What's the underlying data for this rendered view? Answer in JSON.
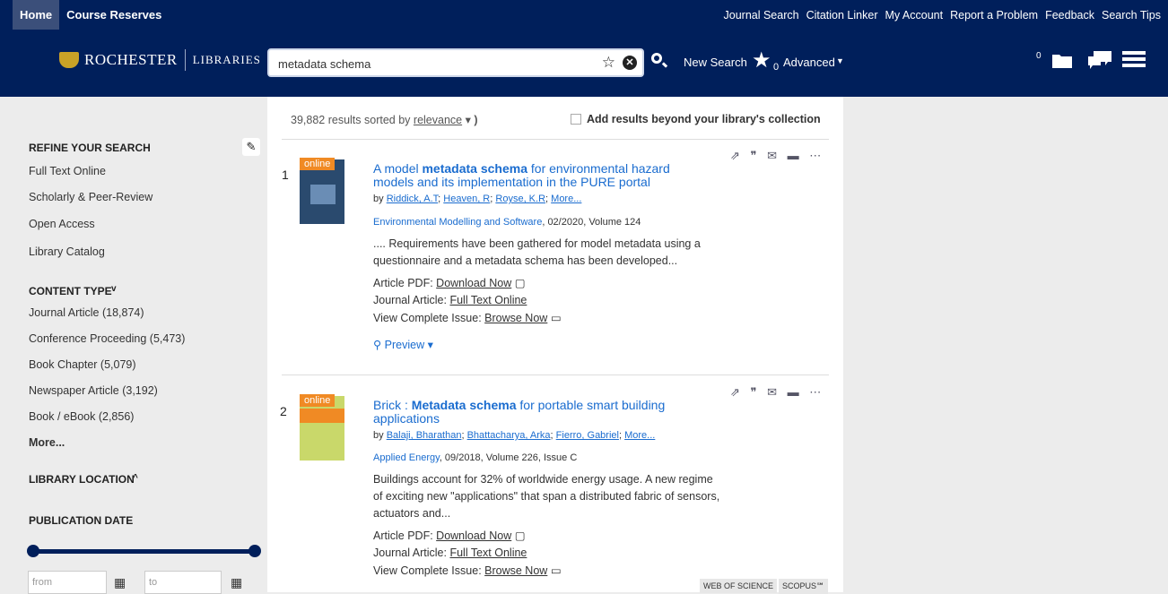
{
  "topnav": {
    "left": [
      "Home",
      "Course Reserves"
    ],
    "right": [
      "Journal Search",
      "Citation Linker",
      "My Account",
      "Report a Problem",
      "Feedback",
      "Search Tips"
    ]
  },
  "header": {
    "logo_uni": "ROCHESTER",
    "logo_lib": "LIBRARIES",
    "search_value": "metadata schema",
    "new_search": "New Search",
    "saved_count": "0",
    "advanced": "Advanced",
    "folder_count": "0"
  },
  "sidebar": {
    "refine": "REFINE YOUR SEARCH",
    "refine_items": [
      "Full Text Online",
      "Scholarly & Peer-Review",
      "Open Access",
      "Library Catalog"
    ],
    "content_type": "CONTENT TYPE",
    "content_items": [
      "Journal Article (18,874)",
      "Conference Proceeding (5,473)",
      "Book Chapter (5,079)",
      "Newspaper Article (3,192)",
      "Book / eBook (2,856)"
    ],
    "more": "More...",
    "library_location": "LIBRARY LOCATION",
    "publication_date": "PUBLICATION DATE",
    "from_placeholder": "from",
    "to_placeholder": "to"
  },
  "summary": {
    "count": "39,882 results sorted by",
    "sort": "relevance",
    "add_results": "Add results beyond your library's collection"
  },
  "results": [
    {
      "num": "1",
      "badge": "online",
      "title_a": "A model ",
      "title_b": "metadata schema",
      "title_c": " for environmental hazard models and its implementation in the PURE portal",
      "by": "by",
      "authors": [
        "Riddick, A.T",
        "Heaven, R",
        "Royse, K.R",
        "More..."
      ],
      "pub": "Environmental Modelling and Software",
      "pub_detail": ", 02/2020, Volume 124",
      "snippet": ".... Requirements have been gathered for model metadata using a questionnaire and a metadata schema has been developed...",
      "link1_label": "Article PDF:",
      "link1": "Download Now",
      "link2_label": "Journal Article:",
      "link2": "Full Text Online",
      "link3_label": "View Complete Issue:",
      "link3": "Browse Now",
      "preview": "Preview"
    },
    {
      "num": "2",
      "badge": "online",
      "title_a": "Brick : ",
      "title_b": "Metadata schema",
      "title_c": " for portable smart building applications",
      "by": "by",
      "authors": [
        "Balaji, Bharathan",
        "Bhattacharya, Arka",
        "Fierro, Gabriel",
        "More..."
      ],
      "pub": "Applied Energy",
      "pub_detail": ", 09/2018, Volume 226, Issue C",
      "snippet": "Buildings account for 32% of worldwide energy usage. A new regime of exciting new \"applications\" that span a distributed fabric of sensors, actuators and...",
      "link1_label": "Article PDF:",
      "link1": "Download Now",
      "link2_label": "Journal Article:",
      "link2": "Full Text Online",
      "link3_label": "View Complete Issue:",
      "link3": "Browse Now",
      "tags": [
        "WEB OF SCIENCE",
        "SCOPUS℠"
      ]
    }
  ]
}
